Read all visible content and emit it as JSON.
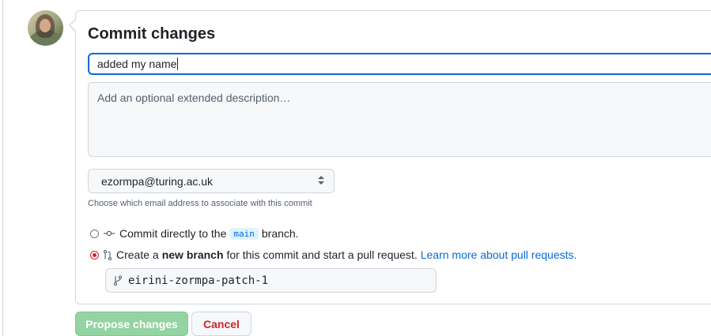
{
  "commit": {
    "title": "Commit changes",
    "summary_value": "added my name",
    "description_placeholder": "Add an optional extended description…",
    "email_selected": "ezormpa@turing.ac.uk",
    "email_hint": "Choose which email address to associate with this commit",
    "option_direct": {
      "prefix": "Commit directly to the",
      "branch": "main",
      "suffix": "branch."
    },
    "option_new_branch": {
      "prefix": "Create a",
      "bold": "new branch",
      "suffix": "for this commit and start a pull request.",
      "link": "Learn more about pull requests."
    },
    "branch_name": "eirini-zormpa-patch-1",
    "propose_label": "Propose changes",
    "cancel_label": "Cancel"
  },
  "colors": {
    "accent": "#0969da",
    "danger": "#cf222e",
    "primary_disabled": "#94d3a2"
  },
  "icons": {
    "commit": "git-commit-icon",
    "pull_request": "git-pull-request-icon",
    "branch": "git-branch-icon",
    "select": "chevron-up-down-icon"
  }
}
